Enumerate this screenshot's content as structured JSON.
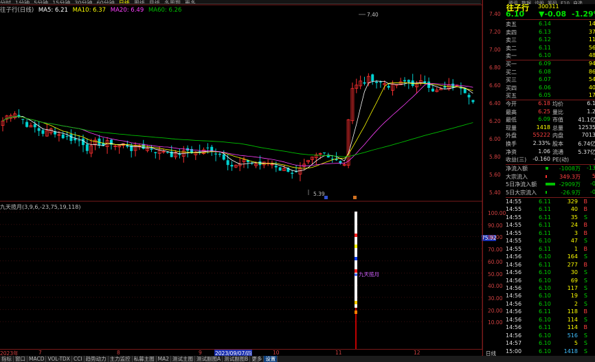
{
  "top_tabs": [
    "分时",
    "1分钟",
    "5分钟",
    "15分钟",
    "30分钟",
    "60分钟",
    "日线",
    "周线",
    "月线",
    "多周期",
    "更多"
  ],
  "top_tabs_active": "日线",
  "top_right_tabs": [
    "资讯",
    "数据",
    "诊股",
    "筹码",
    "F10",
    "自选"
  ],
  "kline_header": {
    "title": "往子行(日线)",
    "ma5": "MA5: 6.21",
    "ma10": "MA10: 6.37",
    "ma20": "MA20: 6.49",
    "ma60": "MA60: 6.26"
  },
  "price_axis": [
    "7.40",
    "7.20",
    "7.00",
    "6.80",
    "6.60",
    "6.40",
    "6.20",
    "6.00",
    "5.80",
    "5.60",
    "5.40"
  ],
  "price_high_label": "7.40",
  "price_low_label": "5.39",
  "indicator": {
    "title": "九天揽月(3,9,6,-23,75,19,118)",
    "axis": [
      "100.00",
      "90.00",
      "80.00",
      "70.00",
      "60.00",
      "50.00",
      "40.00",
      "30.00",
      "20.00",
      "10.00"
    ],
    "marker": "75.92",
    "annotation": "九天揽月"
  },
  "date_bar": {
    "start": "2023年",
    "labels": [
      "7",
      "8",
      "9",
      "10",
      "11",
      "12"
    ],
    "cursor": "2023/09/07/四"
  },
  "bottom_tabs": [
    "指标",
    "窗口",
    "MACD",
    "VOL-TDX",
    "CCI",
    "趋势动力",
    "主力监控",
    "私募主图",
    "MA2",
    "测试主图",
    "测试副图A",
    "测试副图B",
    "更多",
    "设置"
  ],
  "bottom_tabs_active": "设置",
  "bottom_right_label": "日线",
  "right_panel": {
    "stock_name": "往子行",
    "stock_code": "300311",
    "price": "6.10",
    "change": "▼-0.08",
    "change_pct": "-1.29%",
    "asks": [
      {
        "label": "卖五",
        "price": "6.14",
        "vol": "14"
      },
      {
        "label": "卖四",
        "price": "6.13",
        "vol": "37"
      },
      {
        "label": "卖三",
        "price": "6.12",
        "vol": "11"
      },
      {
        "label": "卖二",
        "price": "6.11",
        "vol": "56"
      },
      {
        "label": "卖一",
        "price": "6.10",
        "vol": "48"
      }
    ],
    "bids": [
      {
        "label": "买一",
        "price": "6.09",
        "vol": "94"
      },
      {
        "label": "买二",
        "price": "6.08",
        "vol": "86"
      },
      {
        "label": "买三",
        "price": "6.07",
        "vol": "54"
      },
      {
        "label": "买四",
        "price": "6.06",
        "vol": "40"
      },
      {
        "label": "买五",
        "price": "6.05",
        "vol": "17"
      }
    ],
    "info": [
      {
        "l1": "今开",
        "v1": "6.18",
        "c1": "red",
        "l2": "均价",
        "v2": "6.1"
      },
      {
        "l1": "最高",
        "v1": "6.25",
        "c1": "red",
        "l2": "量比",
        "v2": "1.2"
      },
      {
        "l1": "最低",
        "v1": "6.09",
        "c1": "green",
        "l2": "市值",
        "v2": "41.1亿"
      },
      {
        "l1": "现量",
        "v1": "1418",
        "c1": "yellow",
        "l2": "总量",
        "v2": "12535"
      },
      {
        "l1": "外盘",
        "v1": "55222",
        "c1": "red",
        "l2": "内盘",
        "v2": "7013"
      },
      {
        "l1": "换手",
        "v1": "2.33%",
        "c1": "white",
        "l2": "股本",
        "v2": "6.74亿"
      },
      {
        "l1": "净资",
        "v1": "1.06",
        "c1": "white",
        "l2": "流通",
        "v2": "5.37亿"
      },
      {
        "l1": "收益(三)",
        "v1": "-0.160",
        "c1": "white",
        "l2": "PE(动)",
        "v2": "-"
      }
    ],
    "flows": [
      {
        "label": "净流入额",
        "value": "-1008万",
        "pct": "-13"
      },
      {
        "label": "大宗流入",
        "value": "349.3万",
        "pct": "5"
      },
      {
        "label": "5日净流入额",
        "value": "-2909万",
        "pct": "-0"
      },
      {
        "label": "5日大宗流入",
        "value": "-26.9万",
        "pct": "-0"
      }
    ],
    "ticks": [
      {
        "t": "14:55",
        "p": "6.11",
        "v": "329",
        "d": "B"
      },
      {
        "t": "14:55",
        "p": "6.11",
        "v": "40",
        "d": "B"
      },
      {
        "t": "14:55",
        "p": "6.11",
        "v": "35",
        "d": "S"
      },
      {
        "t": "14:55",
        "p": "6.11",
        "v": "24",
        "d": "B"
      },
      {
        "t": "14:55",
        "p": "6.11",
        "v": "3",
        "d": "B"
      },
      {
        "t": "14:55",
        "p": "6.10",
        "v": "47",
        "d": "S"
      },
      {
        "t": "14:55",
        "p": "6.11",
        "v": "1",
        "d": "B"
      },
      {
        "t": "14:56",
        "p": "6.10",
        "v": "164",
        "d": "S"
      },
      {
        "t": "14:56",
        "p": "6.11",
        "v": "277",
        "d": "B"
      },
      {
        "t": "14:56",
        "p": "6.10",
        "v": "30",
        "d": "S"
      },
      {
        "t": "14:56",
        "p": "6.10",
        "v": "69",
        "d": "S"
      },
      {
        "t": "14:56",
        "p": "6.10",
        "v": "117",
        "d": "S"
      },
      {
        "t": "14:56",
        "p": "6.10",
        "v": "19",
        "d": "S"
      },
      {
        "t": "14:56",
        "p": "6.10",
        "v": "2",
        "d": "S"
      },
      {
        "t": "14:56",
        "p": "6.11",
        "v": "118",
        "d": "B"
      },
      {
        "t": "14:56",
        "p": "6.10",
        "v": "114",
        "d": "S"
      },
      {
        "t": "14:56",
        "p": "6.11",
        "v": "114",
        "d": "B"
      },
      {
        "t": "14:56",
        "p": "6.10",
        "v": "516",
        "d": "S"
      },
      {
        "t": "14:57",
        "p": "6.10",
        "v": "5",
        "d": "S"
      },
      {
        "t": "15:00",
        "p": "6.10",
        "v": "1418",
        "d": "S"
      }
    ]
  },
  "colors": {
    "up": "#ff3030",
    "down": "#00d0d0",
    "ma5": "#ffffff",
    "ma10": "#ffff00",
    "ma20": "#ff40ff",
    "ma60": "#00c000",
    "border": "#7a1a1a"
  }
}
